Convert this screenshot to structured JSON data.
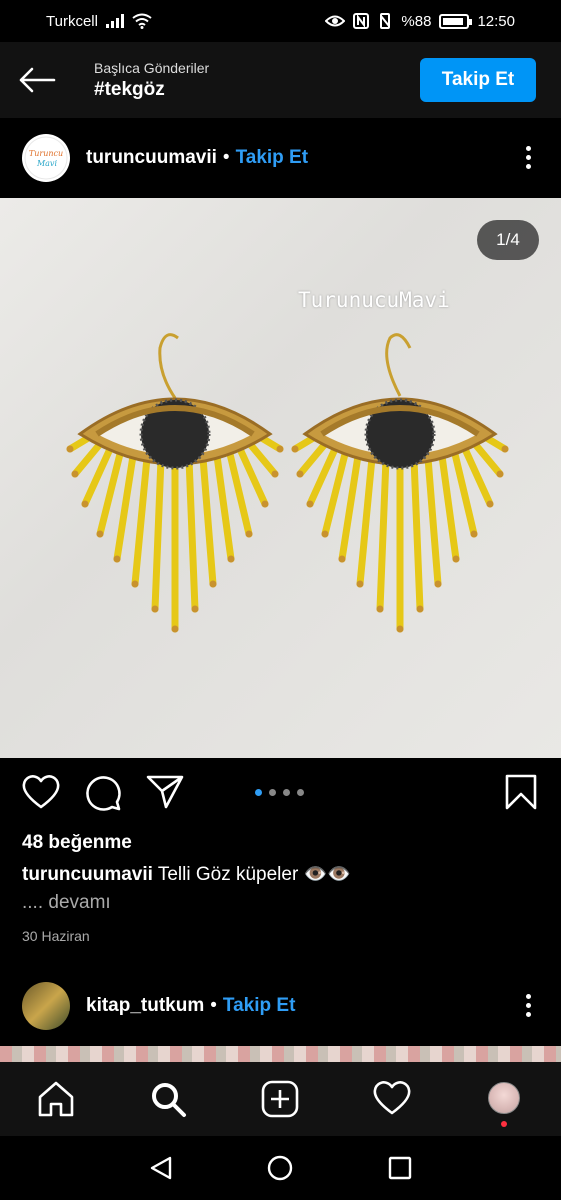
{
  "status_bar": {
    "carrier": "Turkcell",
    "battery": "%88",
    "time": "12:50"
  },
  "header": {
    "subtitle": "Başlıca Gönderiler",
    "title": "#tekgöz",
    "follow_button": "Takip Et"
  },
  "post": {
    "username": "turuncuumavii",
    "separator": "•",
    "follow_link": "Takip Et",
    "image_counter": "1/4",
    "watermark": "TurunucuMavi",
    "avatar_text": "Turuncu Mavi",
    "carousel_total": 4,
    "carousel_active": 1,
    "likes": "48 beğenme",
    "caption_user": "turuncuumavii",
    "caption_text": "Telli Göz küpeler 👁️👁️",
    "more": ".... devamı",
    "date": "30 Haziran"
  },
  "next_post": {
    "username": "kitap_tutkum",
    "separator": "•",
    "follow_link": "Takip Et"
  },
  "colors": {
    "accent": "#0095f6",
    "link": "#2f9df5",
    "background": "#000000",
    "bar": "#121212"
  },
  "icons": {
    "back": "arrow-left-icon",
    "more": "more-vertical-icon",
    "like": "heart-icon",
    "comment": "comment-icon",
    "share": "send-icon",
    "save": "bookmark-icon",
    "home": "home-icon",
    "search": "search-icon",
    "add": "add-post-icon",
    "activity": "heart-icon",
    "profile": "profile-avatar"
  }
}
